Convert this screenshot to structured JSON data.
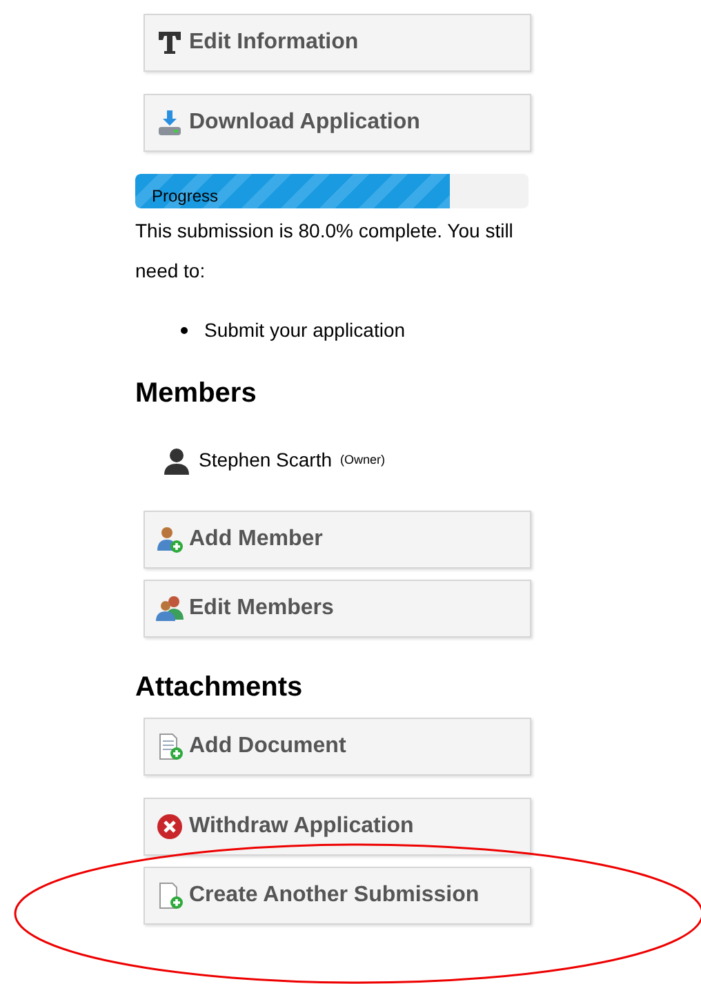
{
  "actions": [
    {
      "label": "Edit Information",
      "kind": "text"
    },
    {
      "label": "Download Application",
      "kind": "download"
    }
  ],
  "progress": {
    "label": "Progress",
    "level": 0.8
  },
  "status_text": "This submission is 80.0% complete. You still need to:",
  "todo": [
    "Submit your application"
  ],
  "members": {
    "heading": "Members",
    "people": [
      {
        "name": "Stephen Scarth",
        "role": "(Owner)"
      }
    ],
    "buttons": [
      {
        "label": "Add Member",
        "kind": "add-user"
      },
      {
        "label": "Edit Members",
        "kind": "users"
      }
    ]
  },
  "attachments": {
    "heading": "Attachments",
    "buttons": [
      {
        "label": "Add Document",
        "kind": "add-document"
      },
      {
        "label": "Withdraw Application",
        "kind": "remove"
      },
      {
        "label": "Create Another Submission",
        "kind": "new-document",
        "circled": true
      }
    ]
  }
}
